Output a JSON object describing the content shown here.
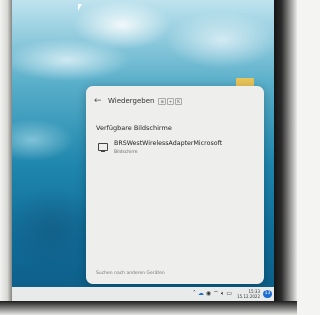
{
  "flyout": {
    "title": "Wiedergeben",
    "shortcut_keys": [
      "⊞",
      "+",
      "K"
    ],
    "section_title": "Verfügbare Bildschirme",
    "devices": [
      {
        "name": "BRSWestWirelessAdapterMicrosoft",
        "type": "Bildschirm",
        "icon": "monitor-icon"
      }
    ],
    "footer_text": "Suchen nach anderen Geräten"
  },
  "taskbar": {
    "tray_icons": [
      "chevron-up-icon",
      "cloud-icon",
      "chrome-icon",
      "wifi-icon",
      "volume-icon",
      "battery-icon"
    ],
    "time": "15:33",
    "date": "15.12.2022",
    "notification_count": "13"
  },
  "colors": {
    "accent": "#1f6fd1",
    "flyout_bg": "#eeeeec",
    "taskbar_bg": "#e9eaea"
  }
}
